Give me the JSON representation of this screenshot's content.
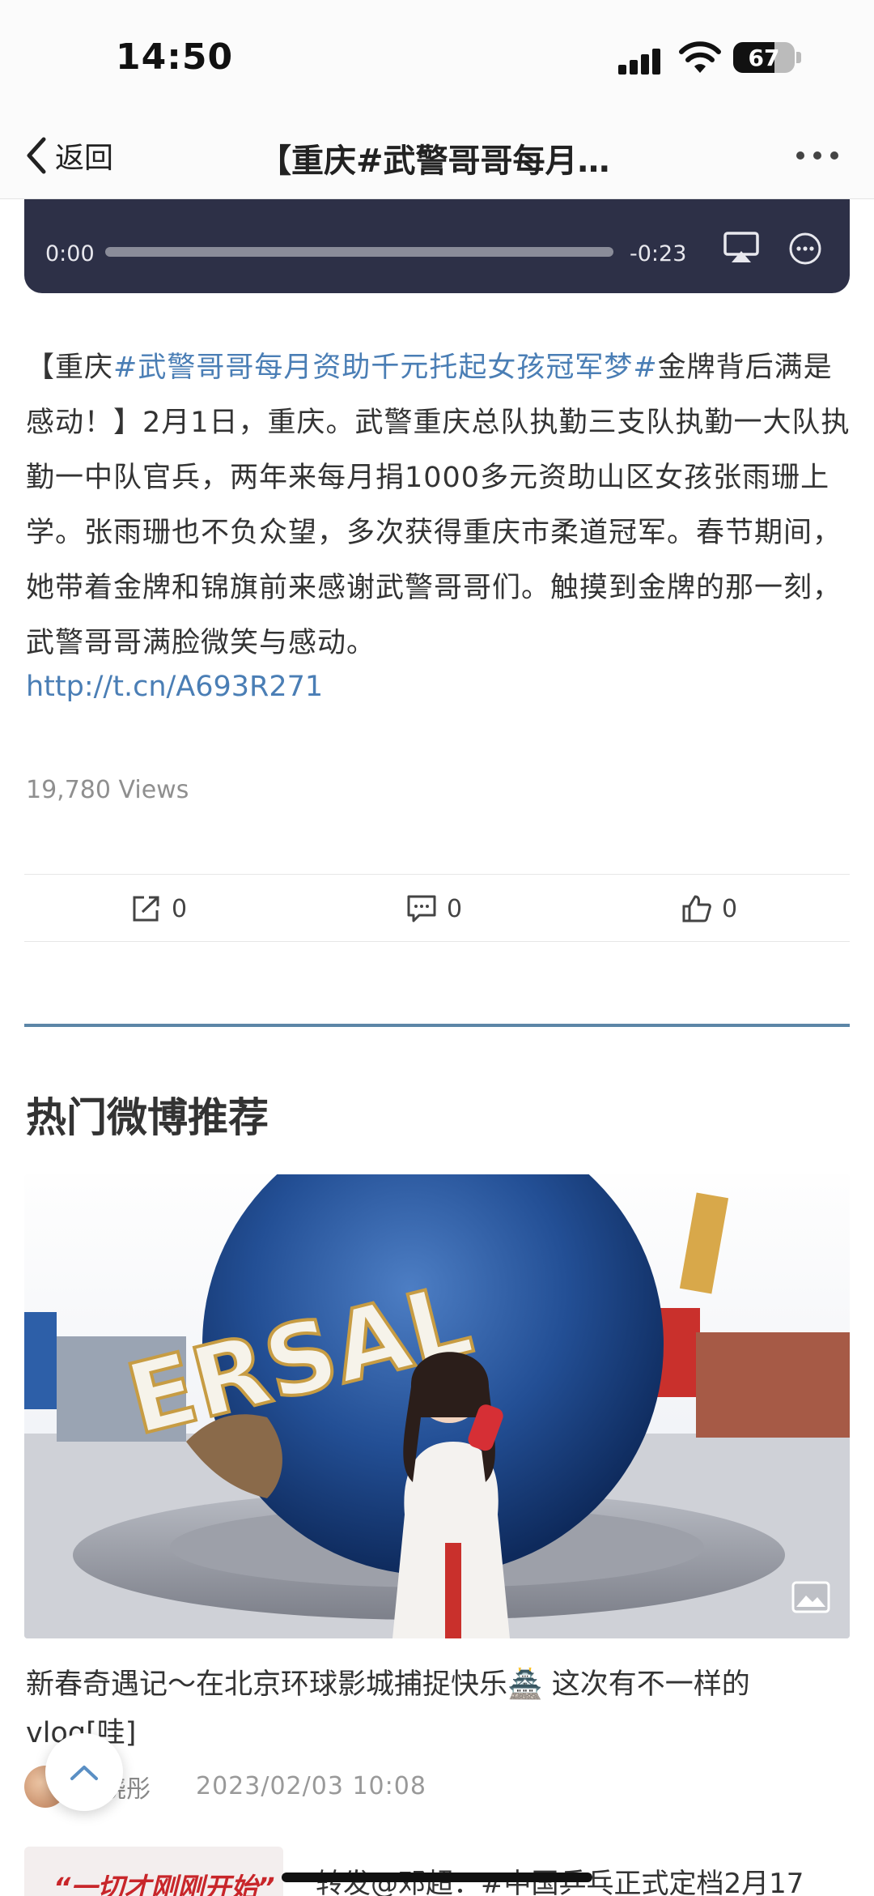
{
  "status_bar": {
    "time": "14:50",
    "battery": "67",
    "battery_level": 0.67
  },
  "nav": {
    "back_label": "返回",
    "title": "【重庆#武警哥哥每月…"
  },
  "video": {
    "current_time": "0:00",
    "remaining_time": "-0:23",
    "progress": 0
  },
  "article": {
    "open_bracket": "【重庆",
    "hashtag": "#武警哥哥每月资助千元托起女孩冠军梦#",
    "body": "金牌背后满是感动！】2月1日，重庆。武警重庆总队执勤三支队执勤一大队执勤一中队官兵，两年来每月捐1000多元资助山区女孩张雨珊上学。张雨珊也不负众望，多次获得重庆市柔道冠军。春节期间，她带着金牌和锦旗前来感谢武警哥哥们。触摸到金牌的那一刻，武警哥哥满脸微笑与感动。",
    "link": "http://t.cn/A693R271",
    "views": "19,780 Views"
  },
  "actions": {
    "share_count": "0",
    "comment_count": "0",
    "like_count": "0"
  },
  "recommend": {
    "section_title": "热门微博推荐",
    "photo_sign": "ERSAL",
    "card_title": "新春奇遇记～在北京环球影城捕捉快乐🏯 这次有不一样的vlog[哇]",
    "author": "人晓彤",
    "time": "2023/02/03 10:08",
    "next_thumb_text": "“一切才刚刚开始”",
    "next_title": "转发@邓超：#中国乒乓正式定档2月17"
  },
  "colors": {
    "link": "#4a7eb5",
    "divider": "#5c86a7",
    "video_bg": "#2d3047"
  }
}
